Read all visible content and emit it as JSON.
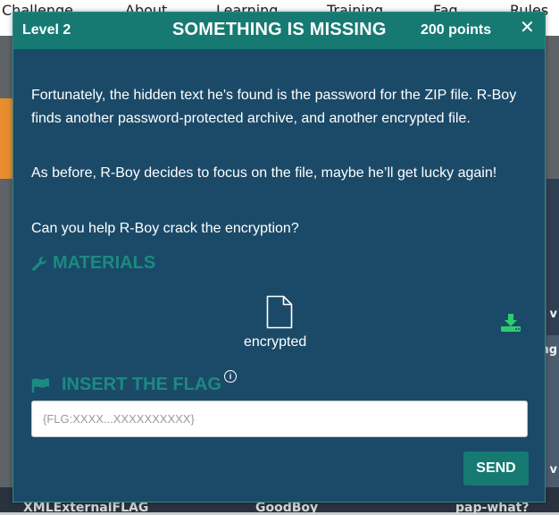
{
  "background": {
    "nav": [
      "Challenge",
      "About",
      "Learning",
      "Training",
      "Faq",
      "Rules"
    ],
    "cards": [
      "XMLExternalFLAG",
      "GoodBoy",
      "pap-what?"
    ],
    "peek": [
      "v",
      "ng",
      "v"
    ]
  },
  "modal": {
    "level": "Level 2",
    "title": "SOMETHING IS MISSING",
    "points": "200 points",
    "close": "✕",
    "paragraphs": [
      "Fortunately, the hidden text he's found is the password for the ZIP file. R-Boy finds another password-protected archive, and another encrypted file.",
      "As before, R-Boy decides to focus on the file, maybe he’ll get lucky again!",
      "Can you help R-Boy crack the encryption?"
    ],
    "materials_heading": "MATERIALS",
    "file_name": "encrypted",
    "flag_heading": "INSERT THE FLAG",
    "flag_placeholder": "{FLG:XXXX...XXXXXXXXXX}",
    "send_label": "SEND"
  },
  "colors": {
    "modal_bg": "#1b4a68",
    "accent": "#167a73",
    "heading": "#1c8a80",
    "download": "#2ecc71"
  }
}
